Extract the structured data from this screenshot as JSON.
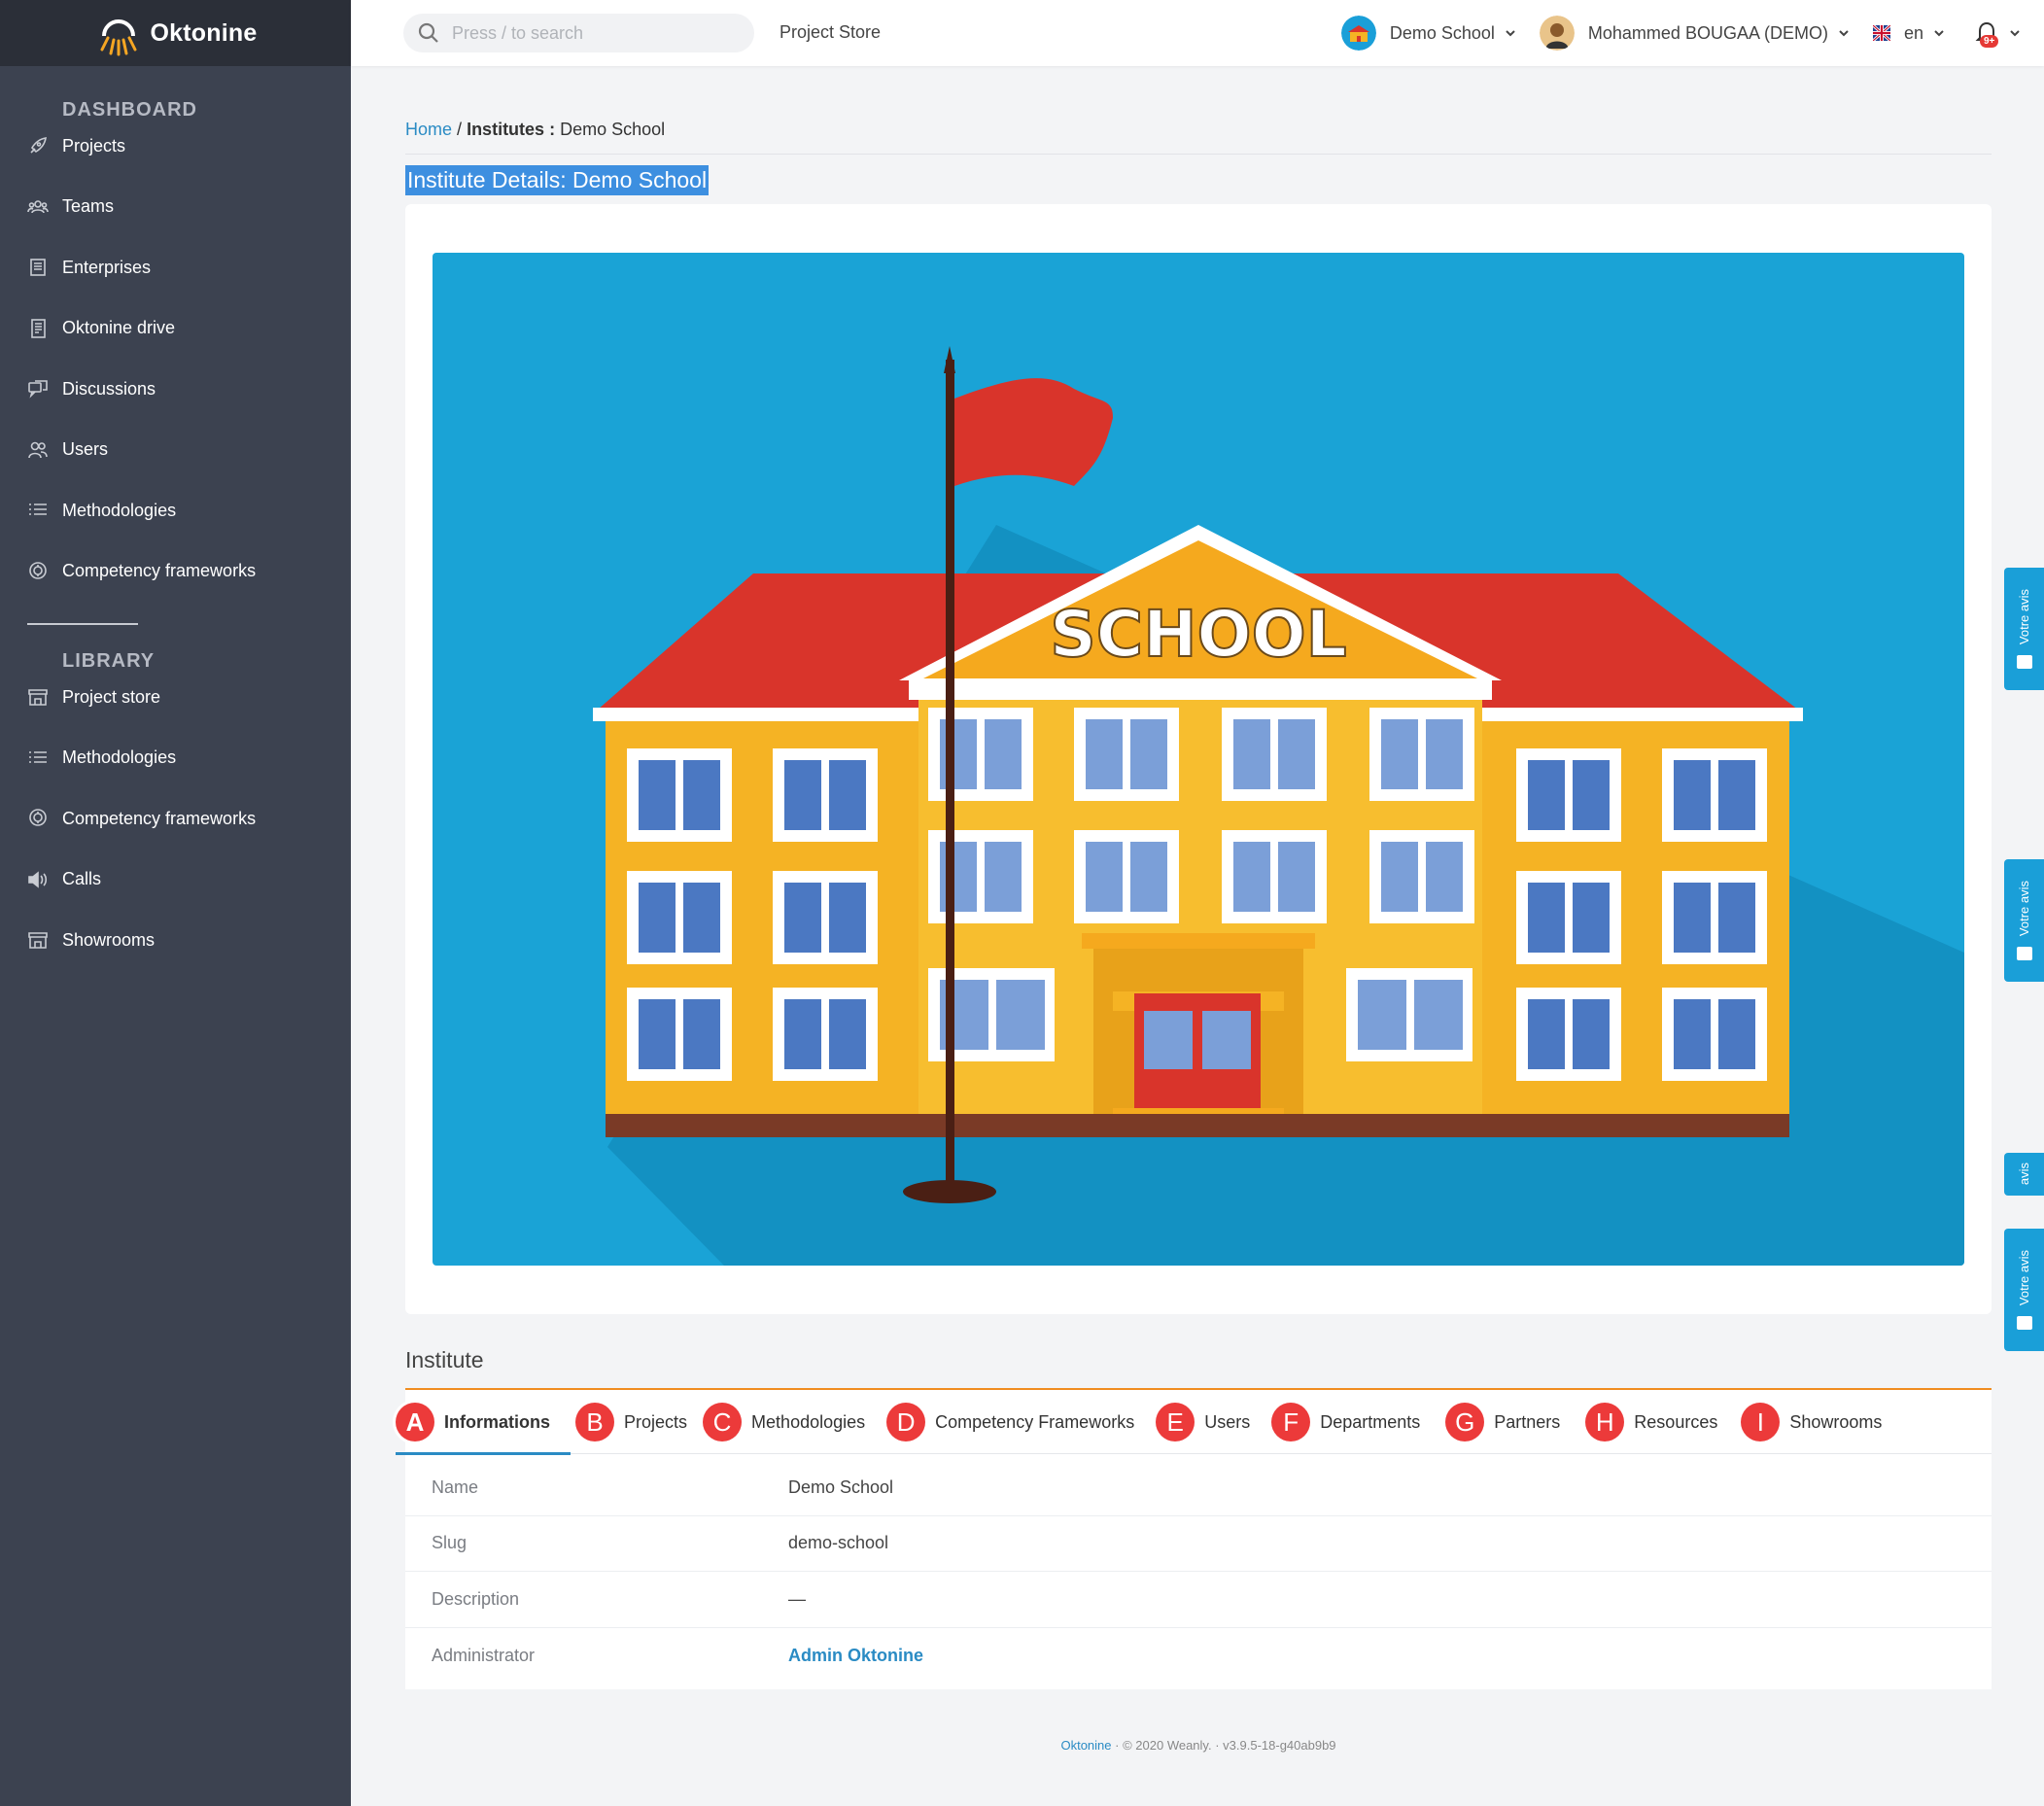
{
  "brand": {
    "name": "Oktonine"
  },
  "sidebar": {
    "dashboard_title": "DASHBOARD",
    "dashboard_items": [
      {
        "label": "Projects",
        "icon": "rocket-icon"
      },
      {
        "label": "Teams",
        "icon": "team-icon"
      },
      {
        "label": "Enterprises",
        "icon": "building-icon"
      },
      {
        "label": "Oktonine drive",
        "icon": "drive-icon"
      },
      {
        "label": "Discussions",
        "icon": "chat-icon"
      },
      {
        "label": "Users",
        "icon": "users-icon"
      },
      {
        "label": "Methodologies",
        "icon": "list-icon"
      },
      {
        "label": "Competency frameworks",
        "icon": "badge-icon"
      }
    ],
    "library_title": "LIBRARY",
    "library_items": [
      {
        "label": "Project store",
        "icon": "store-icon"
      },
      {
        "label": "Methodologies",
        "icon": "list-icon"
      },
      {
        "label": "Competency frameworks",
        "icon": "badge-icon"
      },
      {
        "label": "Calls",
        "icon": "speaker-icon"
      },
      {
        "label": "Showrooms",
        "icon": "store-icon"
      }
    ]
  },
  "topbar": {
    "search_placeholder": "Press / to search",
    "project_store": "Project Store",
    "school": "Demo School",
    "user": "Mohammed BOUGAA (DEMO)",
    "language": "en",
    "notification_badge": "9+"
  },
  "breadcrumb": {
    "home": "Home",
    "separator": "/",
    "section": "Institutes :",
    "current": "Demo School"
  },
  "page_title": "Institute Details: Demo School",
  "image": {
    "sign_text": "SCHOOL"
  },
  "institute": {
    "title": "Institute",
    "tabs": [
      {
        "marker": "A",
        "label": "Informations"
      },
      {
        "marker": "B",
        "label": "Projects"
      },
      {
        "marker": "C",
        "label": "Methodologies"
      },
      {
        "marker": "D",
        "label": "Competency Frameworks"
      },
      {
        "marker": "E",
        "label": "Users"
      },
      {
        "marker": "F",
        "label": "Departments"
      },
      {
        "marker": "G",
        "label": "Partners"
      },
      {
        "marker": "H",
        "label": "Resources"
      },
      {
        "marker": "I",
        "label": "Showrooms"
      }
    ],
    "rows": [
      {
        "label": "Name",
        "value": "Demo School"
      },
      {
        "label": "Slug",
        "value": "demo-school"
      },
      {
        "label": "Description",
        "value": "—"
      },
      {
        "label": "Administrator",
        "value": "Admin Oktonine"
      }
    ]
  },
  "footer": {
    "brand": "Oktonine",
    "copyright": "© 2020 Weanly.",
    "version": "v3.9.5-18-g40ab9b9"
  },
  "feedback": [
    {
      "label": "Votre avis"
    },
    {
      "label": "Votre avis"
    },
    {
      "label": "avis"
    },
    {
      "label": "Votre avis"
    }
  ],
  "colors": {
    "sidebar": "#3c4250",
    "accent": "#2a8bc4",
    "orange": "#f08c20",
    "marker": "#ec3a3a",
    "sky": "#1a9fd8"
  }
}
